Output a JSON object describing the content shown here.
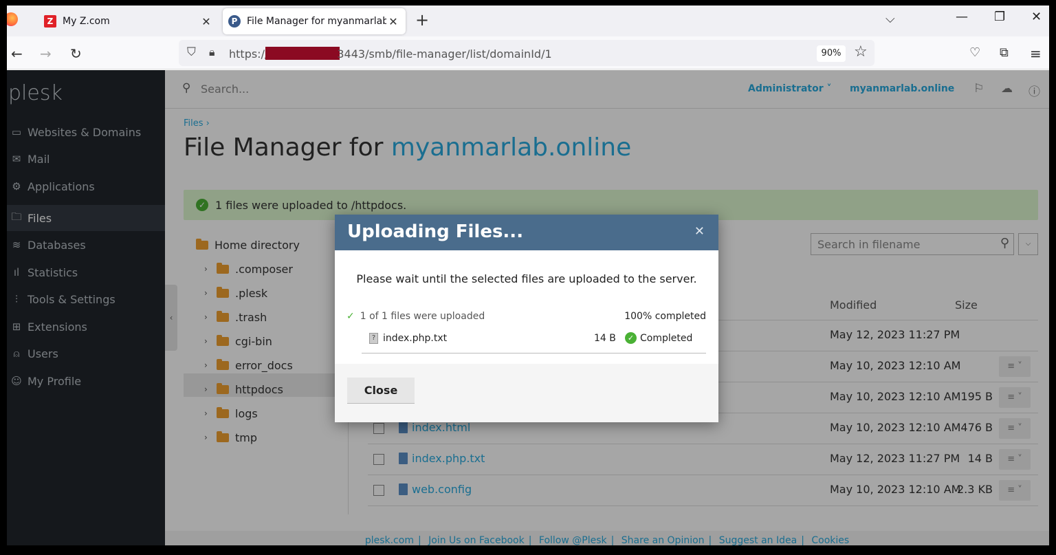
{
  "browser": {
    "tabs": [
      {
        "title": "My Z.com",
        "favicon": "Z"
      },
      {
        "title": "File Manager for myanmarlab.o",
        "favicon": "P"
      }
    ],
    "url_prefix": "https://",
    "url_suffix": "3443/smb/file-manager/list/domainId/1",
    "zoom": "90%"
  },
  "plesk": {
    "logo": "plesk",
    "search_placeholder": "Search...",
    "user": "Administrator ˅",
    "domain": "myanmarlab.online",
    "sidebar": [
      {
        "label": "Websites & Domains",
        "icon": "monitor-icon"
      },
      {
        "label": "Mail",
        "icon": "mail-icon"
      },
      {
        "label": "Applications",
        "icon": "gear-icon"
      },
      {
        "label": "Files",
        "icon": "folder-icon"
      },
      {
        "label": "Databases",
        "icon": "database-icon"
      },
      {
        "label": "Statistics",
        "icon": "chart-icon"
      },
      {
        "label": "Tools & Settings",
        "icon": "sliders-icon"
      },
      {
        "label": "Extensions",
        "icon": "grid-icon"
      },
      {
        "label": "Users",
        "icon": "user-icon"
      },
      {
        "label": "My Profile",
        "icon": "profile-icon"
      }
    ],
    "active_item": "Files",
    "breadcrumb": "Files  ›",
    "title_prefix": "File Manager for",
    "title_domain": "myanmarlab.online",
    "message": "1 files were uploaded to /httpdocs.",
    "tree": {
      "root": "Home directory",
      "folders": [
        ".composer",
        ".plesk",
        ".trash",
        "cgi-bin",
        "error_docs",
        "httpdocs",
        "logs",
        "tmp"
      ]
    },
    "filename_search_placeholder": "Search in filename",
    "columns": {
      "modified": "Modified",
      "size": "Size"
    },
    "rows": [
      {
        "name": "",
        "modified": "May 12, 2023 11:27 PM",
        "size": ""
      },
      {
        "name": "",
        "modified": "May 10, 2023 12:10 AM",
        "size": ""
      },
      {
        "name": "",
        "modified": "May 10, 2023 12:10 AM",
        "size": "195 B"
      },
      {
        "name": "index.html",
        "modified": "May 10, 2023 12:10 AM",
        "size": "476 B"
      },
      {
        "name": "index.php.txt",
        "modified": "May 12, 2023 11:27 PM",
        "size": "14 B"
      },
      {
        "name": "web.config",
        "modified": "May 10, 2023 12:10 AM",
        "size": "2.3 KB"
      }
    ],
    "footer": [
      "plesk.com",
      "Join Us on Facebook",
      "Follow @Plesk",
      "Share an Opinion",
      "Suggest an Idea",
      "Cookies"
    ]
  },
  "modal": {
    "title": "Uploading Files...",
    "description": "Please wait until the selected files are uploaded to the server.",
    "progress_text": "1 of 1 files were uploaded",
    "progress_percent": "100% completed",
    "progress": 1.0,
    "file": {
      "name": "index.php.txt",
      "size": "14 B",
      "status": "Completed"
    },
    "close_label": "Close"
  },
  "colors": {
    "accent": "#28aade",
    "sidebar": "#21262c",
    "modal_header": "#4a6c8c",
    "success": "#4ab135"
  }
}
